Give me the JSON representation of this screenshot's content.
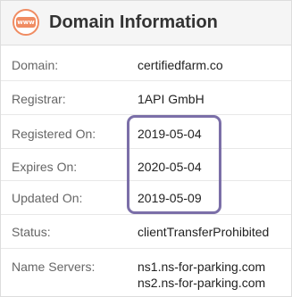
{
  "header": {
    "icon_text": "www",
    "title": "Domain Information"
  },
  "rows": [
    {
      "label": "Domain:",
      "value": "certifiedfarm.co"
    },
    {
      "label": "Registrar:",
      "value": "1API GmbH"
    },
    {
      "label": "Registered On:",
      "value": "2019-05-04"
    },
    {
      "label": "Expires On:",
      "value": "2020-05-04"
    },
    {
      "label": "Updated On:",
      "value": "2019-05-09"
    },
    {
      "label": "Status:",
      "value": "clientTransferProhibited"
    },
    {
      "label": "Name Servers:",
      "values": [
        "ns1.ns-for-parking.com",
        "ns2.ns-for-parking.com"
      ]
    }
  ],
  "colors": {
    "accent": "#f08c62",
    "highlight": "#7b6fa8",
    "header_bg": "#f5f5f5"
  }
}
